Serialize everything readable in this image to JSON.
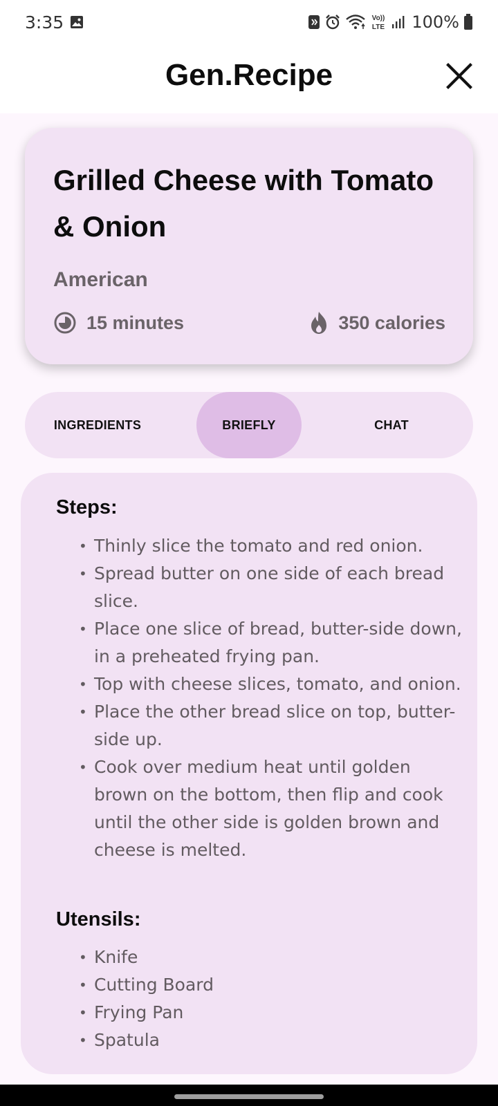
{
  "status_bar": {
    "time": "3:35",
    "battery": "100%",
    "icons": [
      "gallery-icon",
      "nfc-icon",
      "alarm-icon",
      "wifi-icon",
      "volte-icon",
      "signal-icon",
      "battery-icon"
    ],
    "volte_label_top": "Vo))",
    "volte_label_bottom": "LTE"
  },
  "header": {
    "title": "Gen.Recipe",
    "close_icon": "close-icon"
  },
  "recipe": {
    "title": "Grilled Cheese with Tomato & Onion",
    "cuisine": "American",
    "time": "15 minutes",
    "calories": "350 calories",
    "time_icon": "timer-icon",
    "calories_icon": "flame-icon"
  },
  "tabs": [
    {
      "label": "INGREDIENTS",
      "selected": false
    },
    {
      "label": "BRIEFLY",
      "selected": true
    },
    {
      "label": "CHAT",
      "selected": false
    }
  ],
  "content": {
    "steps_heading": "Steps:",
    "steps": [
      "Thinly slice the tomato and red onion.",
      "Spread butter on one side of each bread slice.",
      "Place one slice of bread, butter-side down, in a preheated frying pan.",
      "Top with cheese slices, tomato, and onion.",
      "Place the other bread slice on top, butter-side up.",
      "Cook over medium heat until golden brown on the bottom, then flip and cook until the other side is golden brown and cheese is melted."
    ],
    "utensils_heading": "Utensils:",
    "utensils": [
      "Knife",
      "Cutting Board",
      "Frying Pan",
      "Spatula"
    ]
  },
  "colors": {
    "card_background": "#f2e2f4",
    "selected_tab": "#dfbde6",
    "page_background": "#fdf6fd",
    "muted_text": "#6a6368"
  }
}
